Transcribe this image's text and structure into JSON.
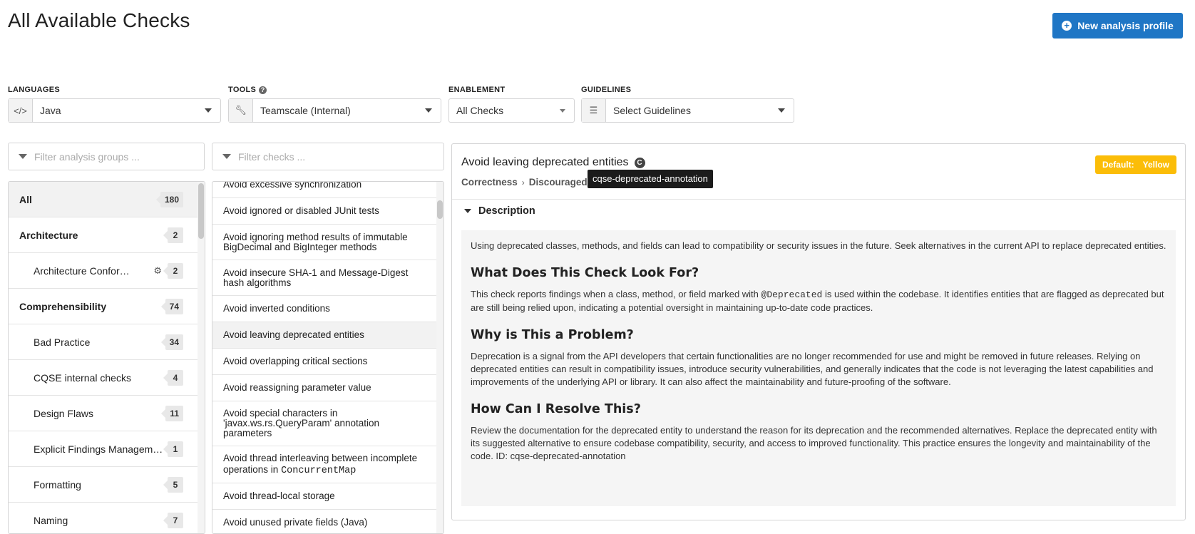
{
  "page": {
    "title": "All Available Checks",
    "new_profile_label": "New analysis profile"
  },
  "filters": {
    "languages": {
      "label": "LANGUAGES",
      "value": "Java"
    },
    "tools": {
      "label": "TOOLS",
      "value": "Teamscale (Internal)"
    },
    "enablement": {
      "label": "ENABLEMENT",
      "value": "All Checks"
    },
    "guidelines": {
      "label": "GUIDELINES",
      "value": "Select Guidelines"
    }
  },
  "search": {
    "groups_placeholder": "Filter analysis groups ...",
    "checks_placeholder": "Filter checks ..."
  },
  "groups": [
    {
      "label": "All",
      "count": "180",
      "level": "top",
      "active": true
    },
    {
      "label": "Architecture",
      "count": "2",
      "level": "top"
    },
    {
      "label": "Architecture Conform…",
      "count": "2",
      "level": "sub",
      "gear": true
    },
    {
      "label": "Comprehensibility",
      "count": "74",
      "level": "top"
    },
    {
      "label": "Bad Practice",
      "count": "34",
      "level": "sub"
    },
    {
      "label": "CQSE internal checks",
      "count": "4",
      "level": "sub"
    },
    {
      "label": "Design Flaws",
      "count": "11",
      "level": "sub"
    },
    {
      "label": "Explicit Findings Managem…",
      "count": "1",
      "level": "sub"
    },
    {
      "label": "Formatting",
      "count": "5",
      "level": "sub"
    },
    {
      "label": "Naming",
      "count": "7",
      "level": "sub"
    }
  ],
  "checks": [
    {
      "label": "Avoid excessive synchronization"
    },
    {
      "label": "Avoid ignored or disabled JUnit tests"
    },
    {
      "label": "Avoid ignoring method results of immutable BigDecimal and BigInteger methods"
    },
    {
      "label": "Avoid insecure SHA-1 and Message-Digest hash algorithms"
    },
    {
      "label": "Avoid inverted conditions"
    },
    {
      "label": "Avoid leaving deprecated entities",
      "active": true
    },
    {
      "label": "Avoid overlapping critical sections"
    },
    {
      "label": "Avoid reassigning parameter value"
    },
    {
      "label": "Avoid special characters in 'javax.ws.rs.QueryParam' annotation parameters"
    },
    {
      "label": "Avoid thread interleaving between incomplete operations in ",
      "code": "ConcurrentMap"
    },
    {
      "label": "Avoid thread-local storage"
    },
    {
      "label": "Avoid unused private fields (Java)"
    }
  ],
  "detail": {
    "title": "Avoid leaving deprecated entities",
    "breadcrumb": [
      "Correctness",
      "Discouraged"
    ],
    "tooltip": "cqse-deprecated-annotation",
    "default_label": "Default:",
    "default_value": "Yellow",
    "description_header": "Description",
    "intro": "Using deprecated classes, methods, and fields can lead to compatibility or security issues in the future. Seek alternatives in the current API to replace deprecated entities.",
    "h1": "What Does This Check Look For?",
    "p1_before": "This check reports findings when a class, method, or field marked with ",
    "p1_code": "@Deprecated",
    "p1_after": " is used within the codebase. It identifies entities that are flagged as deprecated but are still being relied upon, indicating a potential oversight in maintaining up-to-date code practices.",
    "h2": "Why is This a Problem?",
    "p2": "Deprecation is a signal from the API developers that certain functionalities are no longer recommended for use and might be removed in future releases. Relying on deprecated entities can result in compatibility issues, introduce security vulnerabilities, and generally indicates that the code is not leveraging the latest capabilities and improvements of the underlying API or library. It can also affect the maintainability and future-proofing of the software.",
    "h3": "How Can I Resolve This?",
    "p3": "Review the documentation for the deprecated entity to understand the reason for its deprecation and the recommended alternatives. Replace the deprecated entity with its suggested alternative to ensure codebase compatibility, security, and access to improved functionality. This practice ensures the longevity and maintainability of the code. ID: cqse-deprecated-annotation"
  },
  "colors": {
    "primary": "#1f76c5",
    "badge_yellow": "#fbbd08"
  }
}
